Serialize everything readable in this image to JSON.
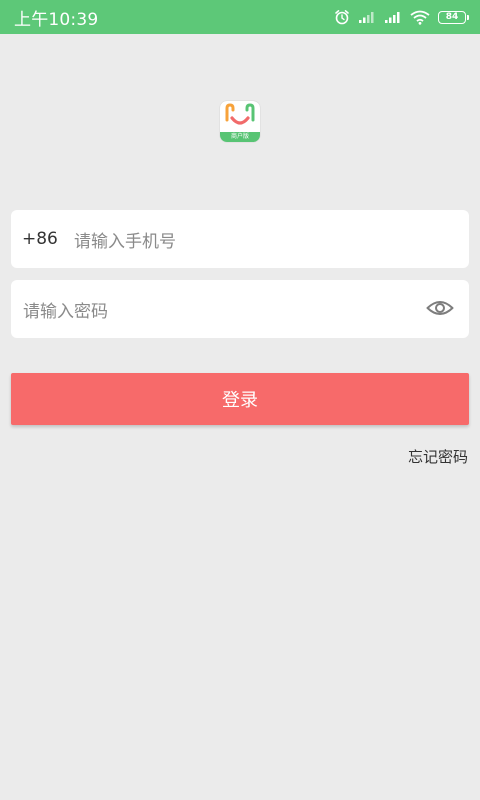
{
  "status_bar": {
    "time": "上午10:39",
    "battery": "84",
    "icons": [
      "alarm-icon",
      "signal-icon",
      "signal-icon",
      "wifi-icon",
      "battery-icon"
    ]
  },
  "logo": {
    "strip_text": "商户版"
  },
  "phone_field": {
    "prefix": "+86",
    "placeholder": "请输入手机号"
  },
  "password_field": {
    "placeholder": "请输入密码",
    "toggle_icon": "eye-icon"
  },
  "login_button": {
    "label": "登录"
  },
  "forgot_password": {
    "label": "忘记密码"
  },
  "colors": {
    "status_bar": "#5dc878",
    "background": "#ebebeb",
    "login_button": "#f76a6a"
  }
}
